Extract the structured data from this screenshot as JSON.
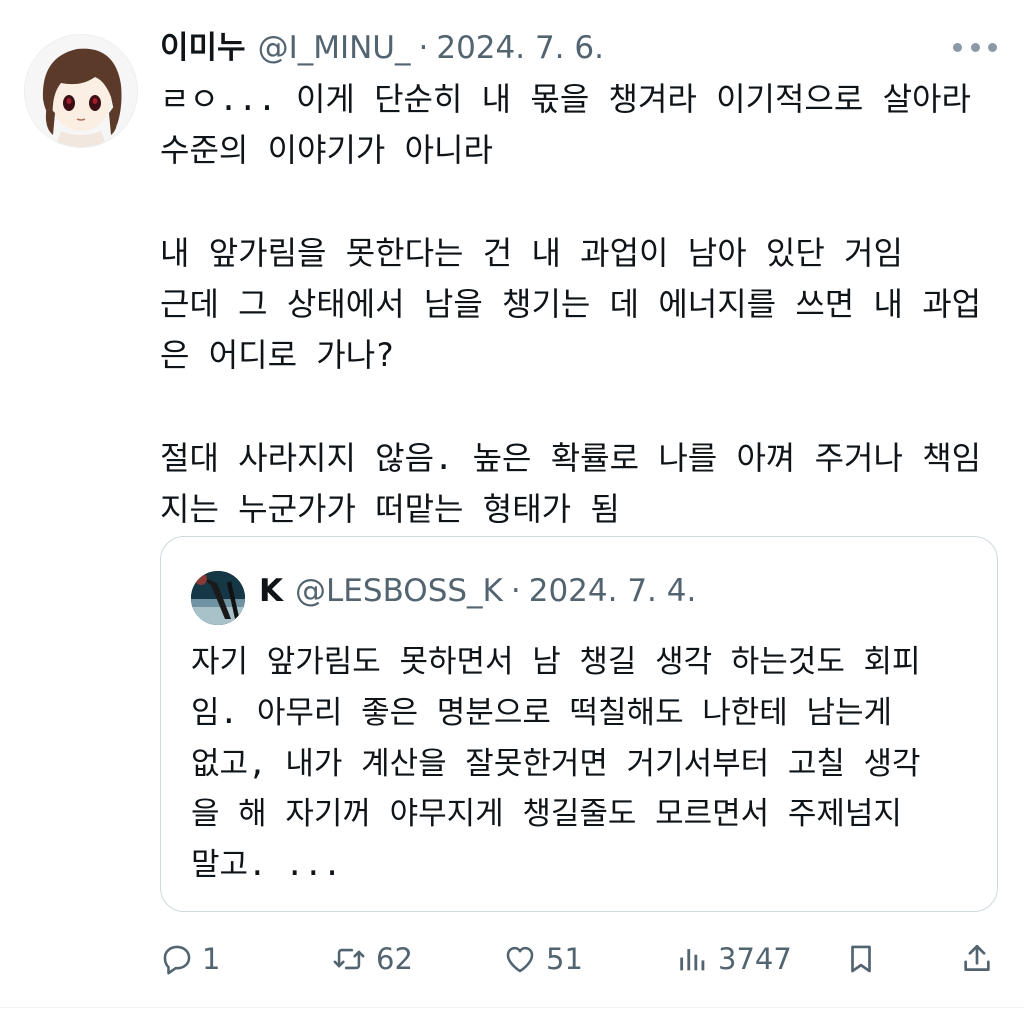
{
  "tweet": {
    "author_name": "이미누",
    "handle": "@I_MINU_",
    "separator": "·",
    "date": "2024. 7. 6.",
    "text": "ㄹㅇ... 이게 단순히 내 몫을 챙겨라 이기적으로 살아라\n수준의 이야기가 아니라\n\n내 앞가림을 못한다는 건 내 과업이 남아 있단 거임\n근데 그 상태에서 남을 챙기는 데 에너지를 쓰면 내 과업\n은 어디로 가나?\n\n절대 사라지지 않음. 높은 확률로 나를 아껴 주거나 책임\n지는 누군가가 떠맡는 형태가 됨"
  },
  "quoted_tweet": {
    "author_name": "K",
    "handle": "@LESBOSS_K",
    "separator": "·",
    "date": "2024. 7. 4.",
    "text": "자기 앞가림도 못하면서 남 챙길 생각 하는것도 회피\n임. 아무리 좋은 명분으로 떡칠해도 나한테 남는게\n없고, 내가 계산을 잘못한거면 거기서부터 고칠 생각\n을 해 자기꺼 야무지게 챙길줄도 모르면서 주제넘지\n말고. ..."
  },
  "actions": {
    "reply_count": "1",
    "retweet_count": "62",
    "like_count": "51",
    "view_count": "3747"
  },
  "icons": {
    "more": "more-dots-icon",
    "reply": "reply-icon",
    "retweet": "retweet-icon",
    "like": "heart-icon",
    "views": "views-bar-icon",
    "bookmark": "bookmark-icon",
    "share": "share-icon"
  },
  "colors": {
    "text": "#0f1419",
    "secondary": "#536471",
    "border": "#cfd9de"
  }
}
